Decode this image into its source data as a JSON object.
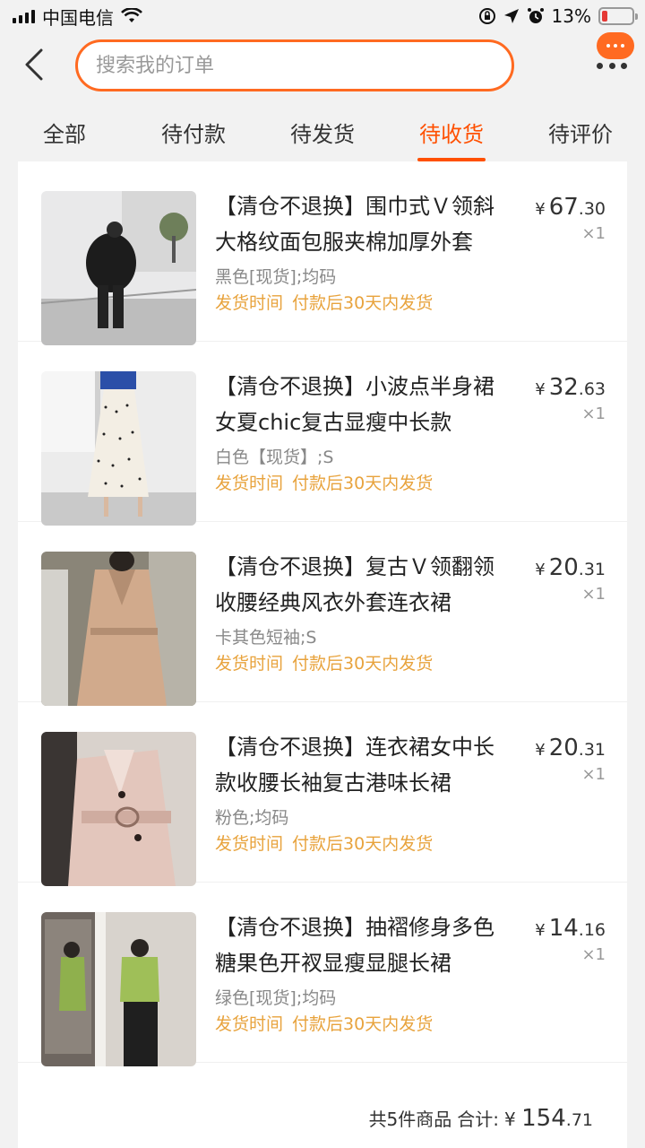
{
  "status_bar": {
    "carrier": "中国电信",
    "battery": "13%"
  },
  "search": {
    "placeholder": "搜索我的订单"
  },
  "tabs": [
    {
      "label": "全部"
    },
    {
      "label": "待付款"
    },
    {
      "label": "待发货"
    },
    {
      "label": "待收货",
      "active": true
    },
    {
      "label": "待评价"
    }
  ],
  "items": [
    {
      "title": "【清仓不退换】围巾式Ｖ领斜大格纹面包服夹棉加厚外套",
      "sku": "黑色[现货];均码",
      "ship_label": "发货时间",
      "ship_value": "付款后30天内发货",
      "price_currency": "¥",
      "price_int": "67",
      "price_dec": ".30",
      "qty": "×1"
    },
    {
      "title": "【清仓不退换】小波点半身裙女夏chic复古显瘦中长款",
      "sku": "白色【现货】;S",
      "ship_label": "发货时间",
      "ship_value": "付款后30天内发货",
      "price_currency": "¥",
      "price_int": "32",
      "price_dec": ".63",
      "qty": "×1"
    },
    {
      "title": "【清仓不退换】复古Ｖ领翻领收腰经典风衣外套连衣裙",
      "sku": "卡其色短袖;S",
      "ship_label": "发货时间",
      "ship_value": "付款后30天内发货",
      "price_currency": "¥",
      "price_int": "20",
      "price_dec": ".31",
      "qty": "×1"
    },
    {
      "title": "【清仓不退换】连衣裙女中长款收腰长袖复古港味长裙",
      "sku": "粉色;均码",
      "ship_label": "发货时间",
      "ship_value": "付款后30天内发货",
      "price_currency": "¥",
      "price_int": "20",
      "price_dec": ".31",
      "qty": "×1"
    },
    {
      "title": "【清仓不退换】抽褶修身多色糖果色开衩显瘦显腿长裙",
      "sku": "绿色[现货];均码",
      "ship_label": "发货时间",
      "ship_value": "付款后30天内发货",
      "price_currency": "¥",
      "price_int": "14",
      "price_dec": ".16",
      "qty": "×1"
    }
  ],
  "summary": {
    "count_text": "共5件商品",
    "total_label": "合计:",
    "currency": "¥",
    "total_int": "154",
    "total_dec": ".71"
  },
  "colors": {
    "accent": "#ff5000",
    "ship_text": "#e8a33d"
  }
}
